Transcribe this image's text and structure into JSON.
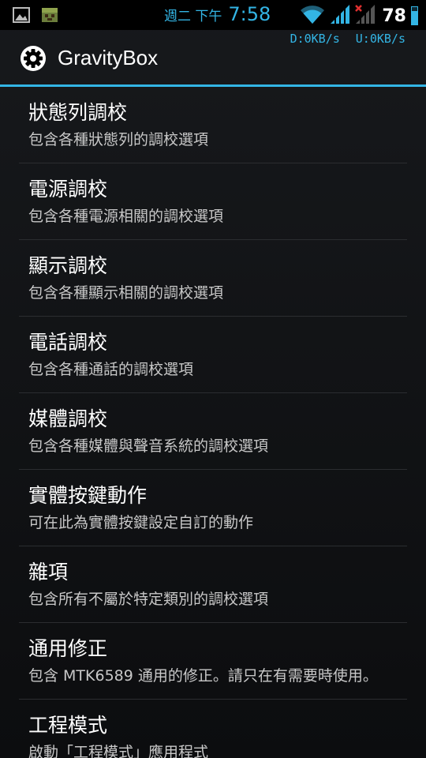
{
  "status_bar": {
    "weekday": "週二 下午",
    "time": "7:58",
    "battery": "78",
    "battery_level": 0.78,
    "left_icons": [
      "gallery-notification-icon",
      "android-notification-icon"
    ],
    "right_icons": [
      "wifi-icon",
      "signal-icon",
      "signal-no-service-icon"
    ]
  },
  "net_speed": {
    "download": "D:0KB/s",
    "upload": "U:0KB/s"
  },
  "action_bar": {
    "title": "GravityBox",
    "icon": "gear-icon"
  },
  "list": [
    {
      "title": "狀態列調校",
      "subtitle": "包含各種狀態列的調校選項"
    },
    {
      "title": "電源調校",
      "subtitle": "包含各種電源相關的調校選項"
    },
    {
      "title": "顯示調校",
      "subtitle": "包含各種顯示相關的調校選項"
    },
    {
      "title": "電話調校",
      "subtitle": "包含各種通話的調校選項"
    },
    {
      "title": "媒體調校",
      "subtitle": "包含各種媒體與聲音系統的調校選項"
    },
    {
      "title": "實體按鍵動作",
      "subtitle": "可在此為實體按鍵設定自訂的動作"
    },
    {
      "title": "雜項",
      "subtitle": "包含所有不屬於特定類別的調校選項"
    },
    {
      "title": "通用修正",
      "subtitle": "包含 MTK6589 通用的修正。請只在有需要時使用。"
    },
    {
      "title": "工程模式",
      "subtitle": "啟動「工程模式」應用程式"
    }
  ],
  "colors": {
    "accent": "#33b5e5",
    "background": "#111315",
    "divider": "#2b2d30"
  }
}
